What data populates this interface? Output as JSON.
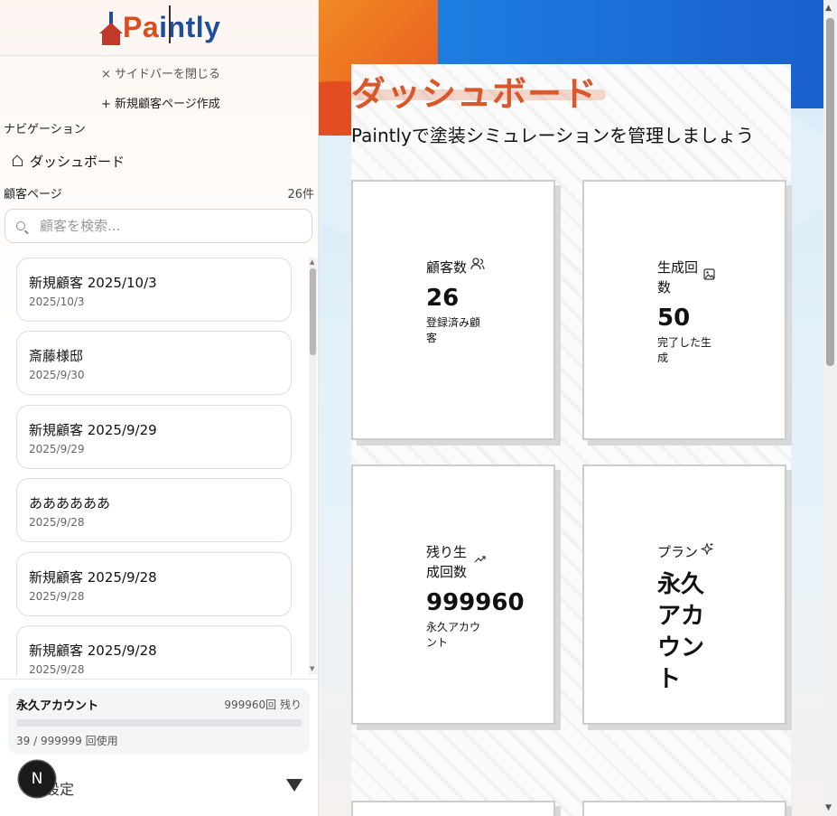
{
  "app": {
    "logo_text_a": "Pa",
    "logo_text_b": "intly"
  },
  "sidebar": {
    "close_label": "× サイドバーを閉じる",
    "new_page_label": "+ 新規顧客ページ作成",
    "nav_section_label": "ナビゲーション",
    "dashboard_label": "ダッシュボード",
    "customers_section_label": "顧客ページ",
    "customers_count": "26件",
    "search_placeholder": "顧客を検索...",
    "customers": [
      {
        "name": "新規顧客 2025/10/3",
        "date": "2025/10/3"
      },
      {
        "name": "斎藤様邸",
        "date": "2025/9/30"
      },
      {
        "name": "新規顧客 2025/9/29",
        "date": "2025/9/29"
      },
      {
        "name": "ああああああ",
        "date": "2025/9/28"
      },
      {
        "name": "新規顧客 2025/9/28",
        "date": "2025/9/28"
      },
      {
        "name": "新規顧客 2025/9/28",
        "date": "2025/9/28"
      }
    ],
    "plan_card": {
      "plan_name": "永久アカウント",
      "remaining": "999960回 残り",
      "usage": "39 / 999999 回使用",
      "usage_fraction": 4e-05
    },
    "settings_label": "設定",
    "badge_letter": "N"
  },
  "main": {
    "title": "ダッシュボード",
    "subtitle": "Paintlyで塗装シミュレーションを管理しましょう",
    "stats": [
      {
        "label": "顧客数",
        "value": "26",
        "desc": "登録済み顧客",
        "icon": "users-icon"
      },
      {
        "label": "生成回数",
        "value": "50",
        "desc": "完了した生成",
        "icon": "image-icon"
      },
      {
        "label": "残り生成回数",
        "value": "999960",
        "desc": "永久アカウント",
        "icon": "trending-icon"
      },
      {
        "label": "プラン",
        "value": "永久アカウント",
        "desc": "",
        "icon": "sparkles-icon"
      }
    ]
  },
  "colors": {
    "brand_orange": "#d9582a",
    "brand_blue": "#1f4e9c",
    "progress": "#3b82f6"
  }
}
